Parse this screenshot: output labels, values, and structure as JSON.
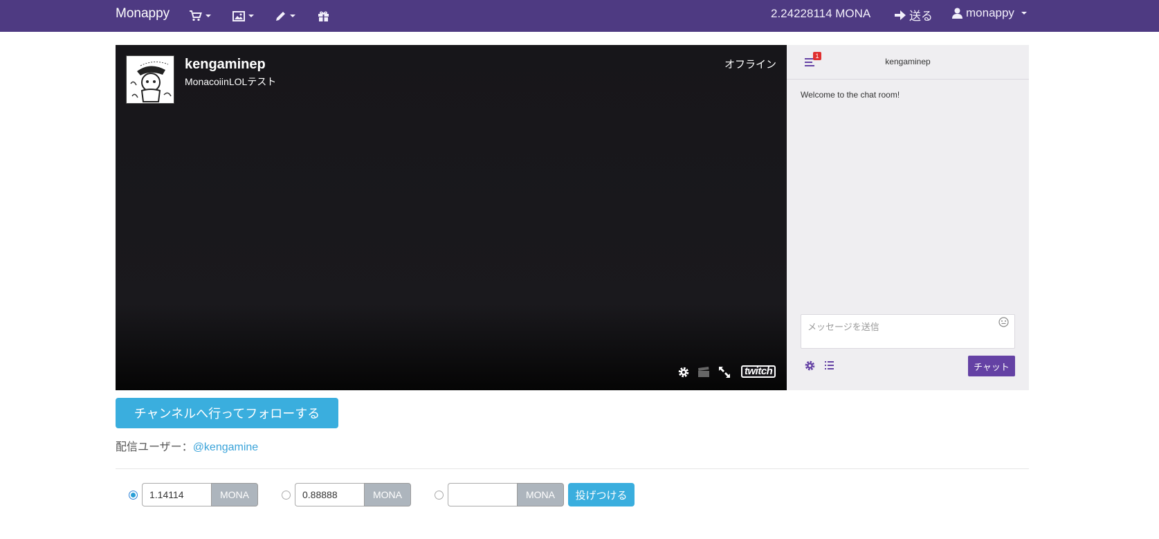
{
  "navbar": {
    "brand": "Monappy",
    "menus": [
      {
        "icon": "cart-icon"
      },
      {
        "icon": "image-icon"
      },
      {
        "icon": "pencil-icon"
      },
      {
        "icon": "gift-icon"
      }
    ],
    "balance": "2.24228114 MONA",
    "send_label": "送る",
    "user_label": "monappy"
  },
  "player": {
    "channel_name": "kengaminep",
    "stream_title": "MonacoiinLOLテスト",
    "status": "オフライン",
    "controls": [
      "gear-icon",
      "clapper-icon",
      "fullscreen-icon"
    ],
    "logo_text": "twitch"
  },
  "chat": {
    "badge_count": "1",
    "title": "kengaminep",
    "welcome": "Welcome to the chat room!",
    "input_placeholder": "メッセージを送信",
    "chat_button": "チャット"
  },
  "follow_button": "チャンネルへ行ってフォローする",
  "streamer": {
    "label": "配信ユーザー：",
    "handle": "@kengamine"
  },
  "tip": {
    "options": [
      {
        "value": "1.14114",
        "unit": "MONA",
        "selected": true
      },
      {
        "value": "0.88888",
        "unit": "MONA",
        "selected": false
      },
      {
        "value": "",
        "unit": "MONA",
        "selected": false
      }
    ],
    "submit_label": "投げつける"
  },
  "colors": {
    "navbar": "#4e3a82",
    "twitch_purple": "#6441a4",
    "accent_blue": "#3aaede",
    "player_bg": "#17161a"
  }
}
